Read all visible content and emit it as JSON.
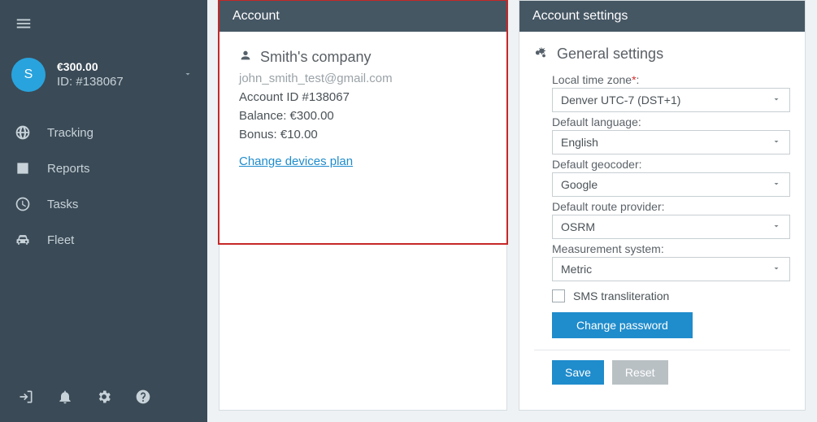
{
  "sidebar": {
    "balance": "€300.00",
    "account_id_prefix": "ID: #",
    "account_id": "138067",
    "avatar_initial": "S",
    "items": [
      {
        "label": "Tracking"
      },
      {
        "label": "Reports"
      },
      {
        "label": "Tasks"
      },
      {
        "label": "Fleet"
      }
    ]
  },
  "account_panel": {
    "title": "Account",
    "company": "Smith's company",
    "email": "john_smith_test@gmail.com",
    "account_id_label": "Account ID #",
    "account_id": "138067",
    "balance_label": "Balance: ",
    "balance_value": "€300.00",
    "bonus_label": "Bonus: ",
    "bonus_value": "€10.00",
    "change_plan_link": "Change devices plan"
  },
  "settings_panel": {
    "title": "Account settings",
    "heading": "General settings",
    "fields": {
      "timezone": {
        "label": "Local time zone",
        "value": "Denver UTC-7 (DST+1)"
      },
      "language": {
        "label": "Default language:",
        "value": "English"
      },
      "geocoder": {
        "label": "Default geocoder:",
        "value": "Google"
      },
      "route": {
        "label": "Default route provider:",
        "value": "OSRM"
      },
      "measurement": {
        "label": "Measurement system:",
        "value": "Metric"
      }
    },
    "sms_transliteration": "SMS transliteration",
    "change_password": "Change password",
    "save": "Save",
    "reset": "Reset"
  }
}
